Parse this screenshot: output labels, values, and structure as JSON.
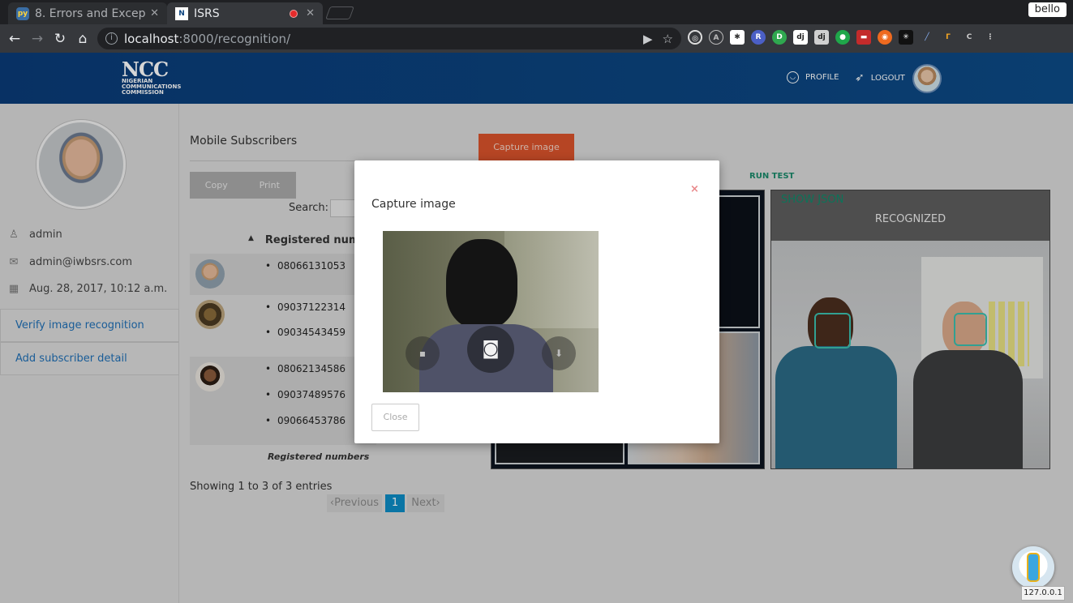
{
  "browser": {
    "tabs": [
      {
        "title": "8. Errors and Excep",
        "active": false
      },
      {
        "title": "ISRS",
        "active": true
      }
    ],
    "profile_name": "bello",
    "url_host": "localhost",
    "url_path": ":8000/recognition/",
    "status_tooltip": "127.0.0.1"
  },
  "header": {
    "logo_text": "NCC",
    "logo_subtitle": [
      "NIGERIAN",
      "COMMUNICATIONS",
      "COMMISSION"
    ],
    "profile_label": "PROFILE",
    "logout_label": "LOGOUT",
    "color": "#0b447f"
  },
  "sidebar": {
    "username": "admin",
    "email": "admin@iwbsrs.com",
    "date": "Aug. 28, 2017, 10:12 a.m.",
    "menu": [
      {
        "label": "Verify image recognition"
      },
      {
        "label": "Add subscriber detail"
      }
    ]
  },
  "main": {
    "title": "Mobile Subscribers",
    "copy_label": "Copy",
    "print_label": "Print",
    "search_label": "Search:",
    "column_header": "Registered numb",
    "rows": [
      {
        "numbers": [
          "08066131053"
        ]
      },
      {
        "numbers": [
          "09037122314",
          "09034543459"
        ]
      },
      {
        "numbers": [
          "08062134586",
          "09037489576",
          "09066453786"
        ]
      }
    ],
    "footer_label": "Registered numbers",
    "showing": "Showing 1 to 3 of 3 entries",
    "pagination": {
      "previous": "Previous",
      "current": "1",
      "next": "Next"
    },
    "capture_button": "Capture image",
    "run_test": "RUN TEST",
    "show_json": "SHOW JSON",
    "recognized": "RECOGNIZED",
    "accent": "#d9532b"
  },
  "modal": {
    "title": "Capture image",
    "close_x": "×",
    "close_button": "Close"
  }
}
